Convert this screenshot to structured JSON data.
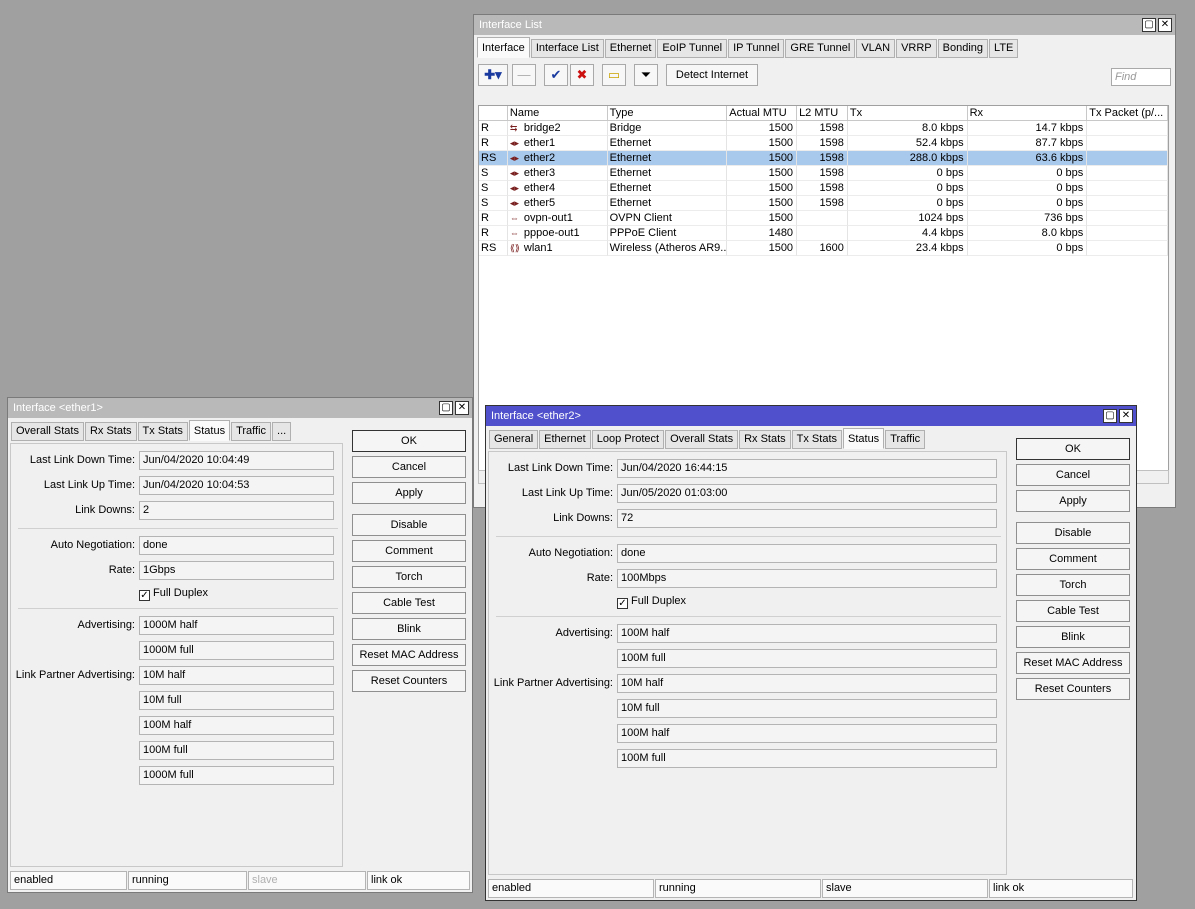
{
  "list_window": {
    "title": "Interface List",
    "tabs": [
      "Interface",
      "Interface List",
      "Ethernet",
      "EoIP Tunnel",
      "IP Tunnel",
      "GRE Tunnel",
      "VLAN",
      "VRRP",
      "Bonding",
      "LTE"
    ],
    "detect_internet_label": "Detect Internet",
    "find_placeholder": "Find",
    "columns": [
      "",
      "Name",
      "Type",
      "Actual MTU",
      "L2 MTU",
      "Tx",
      "Rx",
      "Tx Packet (p/..."
    ],
    "rows": [
      {
        "flag": "R",
        "icon": "bridge-icon",
        "name": "bridge2",
        "type": "Bridge",
        "mtu": "1500",
        "l2mtu": "1598",
        "tx": "8.0 kbps",
        "rx": "14.7 kbps"
      },
      {
        "flag": "R",
        "icon": "ethernet-icon",
        "name": "ether1",
        "type": "Ethernet",
        "mtu": "1500",
        "l2mtu": "1598",
        "tx": "52.4 kbps",
        "rx": "87.7 kbps"
      },
      {
        "flag": "RS",
        "icon": "ethernet-icon",
        "name": "ether2",
        "type": "Ethernet",
        "mtu": "1500",
        "l2mtu": "1598",
        "tx": "288.0 kbps",
        "rx": "63.6 kbps"
      },
      {
        "flag": "S",
        "icon": "ethernet-icon",
        "name": "ether3",
        "type": "Ethernet",
        "mtu": "1500",
        "l2mtu": "1598",
        "tx": "0 bps",
        "rx": "0 bps"
      },
      {
        "flag": "S",
        "icon": "ethernet-icon",
        "name": "ether4",
        "type": "Ethernet",
        "mtu": "1500",
        "l2mtu": "1598",
        "tx": "0 bps",
        "rx": "0 bps"
      },
      {
        "flag": "S",
        "icon": "ethernet-icon",
        "name": "ether5",
        "type": "Ethernet",
        "mtu": "1500",
        "l2mtu": "1598",
        "tx": "0 bps",
        "rx": "0 bps"
      },
      {
        "flag": "R",
        "icon": "tunnel-icon",
        "name": "ovpn-out1",
        "type": "OVPN Client",
        "mtu": "1500",
        "l2mtu": "",
        "tx": "1024 bps",
        "rx": "736 bps"
      },
      {
        "flag": "R",
        "icon": "tunnel-icon",
        "name": "pppoe-out1",
        "type": "PPPoE Client",
        "mtu": "1480",
        "l2mtu": "",
        "tx": "4.4 kbps",
        "rx": "8.0 kbps"
      },
      {
        "flag": "RS",
        "icon": "wireless-icon",
        "name": "wlan1",
        "type": "Wireless (Atheros AR9...",
        "mtu": "1500",
        "l2mtu": "1600",
        "tx": "23.4 kbps",
        "rx": "0 bps"
      }
    ]
  },
  "ether1_window": {
    "title": "Interface <ether1>",
    "tabs": [
      "Overall Stats",
      "Rx Stats",
      "Tx Stats",
      "Status",
      "Traffic",
      "..."
    ],
    "last_link_down_label": "Last Link Down Time:",
    "last_link_down": "Jun/04/2020 10:04:49",
    "last_link_up_label": "Last Link Up Time:",
    "last_link_up": "Jun/04/2020 10:04:53",
    "link_downs_label": "Link Downs:",
    "link_downs": "2",
    "auto_neg_label": "Auto Negotiation:",
    "auto_neg": "done",
    "rate_label": "Rate:",
    "rate": "1Gbps",
    "full_duplex_label": "Full Duplex",
    "advertising_label": "Advertising:",
    "advertising": [
      "1000M half",
      "1000M full"
    ],
    "partner_label": "Link Partner Advertising:",
    "partner": [
      "10M half",
      "10M full",
      "100M half",
      "100M full",
      "1000M full"
    ],
    "status": [
      "enabled",
      "running",
      "slave",
      "link ok"
    ]
  },
  "ether2_window": {
    "title": "Interface <ether2>",
    "tabs": [
      "General",
      "Ethernet",
      "Loop Protect",
      "Overall Stats",
      "Rx Stats",
      "Tx Stats",
      "Status",
      "Traffic"
    ],
    "last_link_down_label": "Last Link Down Time:",
    "last_link_down": "Jun/04/2020 16:44:15",
    "last_link_up_label": "Last Link Up Time:",
    "last_link_up": "Jun/05/2020 01:03:00",
    "link_downs_label": "Link Downs:",
    "link_downs": "72",
    "auto_neg_label": "Auto Negotiation:",
    "auto_neg": "done",
    "rate_label": "Rate:",
    "rate": "100Mbps",
    "full_duplex_label": "Full Duplex",
    "advertising_label": "Advertising:",
    "advertising": [
      "100M half",
      "100M full"
    ],
    "partner_label": "Link Partner Advertising:",
    "partner": [
      "10M half",
      "10M full",
      "100M half",
      "100M full"
    ],
    "status": [
      "enabled",
      "running",
      "slave",
      "link ok"
    ]
  },
  "buttons": [
    "OK",
    "Cancel",
    "Apply",
    "Disable",
    "Comment",
    "Torch",
    "Cable Test",
    "Blink",
    "Reset MAC Address",
    "Reset Counters"
  ]
}
